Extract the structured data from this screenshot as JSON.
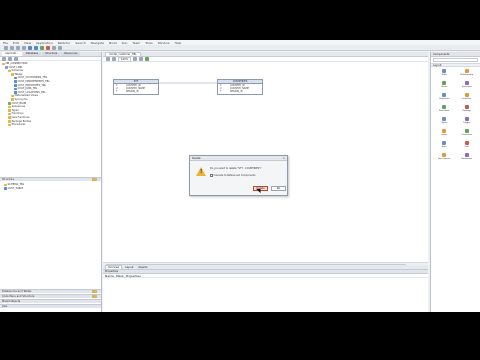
{
  "menubar": {
    "items": [
      "File",
      "Edit",
      "View",
      "Application",
      "Refactor",
      "Search",
      "Navigate",
      "Build",
      "Run",
      "Team",
      "Tools",
      "Window",
      "Help"
    ]
  },
  "left_panel": {
    "tabs": [
      "Applicati...",
      "Database",
      "Structure",
      "Resources"
    ],
    "tree": [
      "DB_CONNECTION",
      "CUST_LINK",
      "Schemas",
      "Tables",
      "CUST_CUSTOMERS_TBL",
      "CUST_DEPARTMENTS_TBL",
      "CUST_EMPLOYEES_TBL",
      "CUST_JOBS_TBL",
      "CUST_LOCATIONS_TBL",
      "Materialized Views",
      "Synonyms",
      "CUST_BLOB",
      "Sequences",
      "Types",
      "Functions",
      "Java Functions",
      "Package Bodies",
      "Procedures"
    ],
    "lower_tree": [
      "SCHEMA_TBL",
      "CUST_TABLE"
    ],
    "sections": [
      "Structure",
      "Datasource and Tables",
      "Code Pane and Structure",
      "Mixed Objects",
      "Jobs"
    ]
  },
  "editor": {
    "tab_label": "model_customer_TBL",
    "zoom": "100%",
    "entities": [
      {
        "title": "STT",
        "rows": [
          {
            "key": "P",
            "name": "COUNTRY_ID"
          },
          {
            "key": "U",
            "name": "COUNTRY_NAME"
          },
          {
            "key": "F",
            "name": "REGION_ID"
          }
        ]
      },
      {
        "title": "COUNTRIES",
        "rows": [
          {
            "key": "P",
            "name": "COUNTRY_ID"
          },
          {
            "key": "U",
            "name": "COUNTRY_NAME"
          },
          {
            "key": "F",
            "name": "REGION_ID"
          }
        ]
      }
    ],
    "bottom_tabs": [
      "Overview",
      "Layout",
      "Objects"
    ],
    "properties_title": "Properties",
    "properties_tabs": [
      "Name",
      "Table",
      "Properties"
    ]
  },
  "right_panel": {
    "title": "Components",
    "section": "Layout",
    "items": [
      {
        "label": "Table",
        "icon": "table-icon"
      },
      {
        "label": "Relationship",
        "icon": "relationship-icon"
      },
      {
        "label": "Views",
        "icon": "view-icon"
      },
      {
        "label": "Synonym",
        "icon": "synonym-icon"
      },
      {
        "label": "Sequence",
        "icon": "sequence-icon"
      },
      {
        "label": "Function",
        "icon": "function-icon"
      },
      {
        "label": "Procedure",
        "icon": "procedure-icon"
      },
      {
        "label": "Package",
        "icon": "package-icon"
      },
      {
        "label": "Types",
        "icon": "types-icon"
      },
      {
        "label": "Trigger",
        "icon": "trigger-icon"
      },
      {
        "label": "Index",
        "icon": "index-icon"
      },
      {
        "label": "Constraint",
        "icon": "constraint-icon"
      },
      {
        "label": "Note",
        "icon": "note-icon"
      },
      {
        "label": "Link",
        "icon": "link-icon"
      },
      {
        "label": "Java Source",
        "icon": "java-source-icon"
      },
      {
        "label": "Bookmark",
        "icon": "bookmark-icon"
      }
    ]
  },
  "dialog": {
    "title": "Delete",
    "message": "Do you want to delete \"STT - COUNTRIES\"?",
    "checkbox_label": "Cascade to Referenced Components",
    "ok_label": "Delete",
    "cancel_label": "No"
  }
}
